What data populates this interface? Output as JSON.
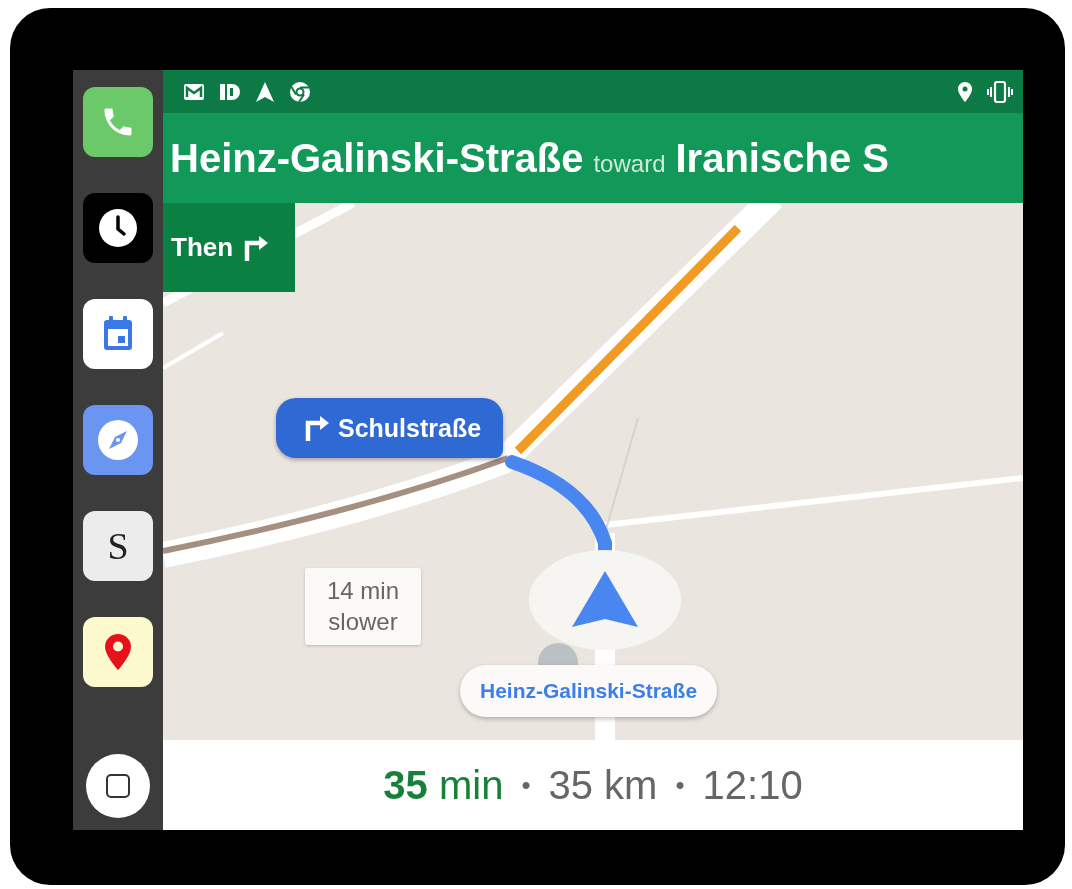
{
  "sidebar": {
    "apps": [
      {
        "kind": "phone",
        "color": "#6cc96a"
      },
      {
        "kind": "clock",
        "color": "#000000"
      },
      {
        "kind": "calendar",
        "color": "#ffffff"
      },
      {
        "kind": "compass",
        "color": "#6a95f0"
      },
      {
        "kind": "letter",
        "label": "S",
        "color": "#ececec"
      },
      {
        "kind": "maps",
        "color": "#fcf9cf"
      }
    ]
  },
  "navigation": {
    "street": "Heinz-Galinski-Straße",
    "connector": "toward",
    "destination": "Iranische S"
  },
  "next_step": {
    "label": "Then"
  },
  "turn_callout": {
    "street": "Schulstraße"
  },
  "traffic_note": {
    "text": "14 min slower"
  },
  "current_road": {
    "label": "Heinz-Galinski-Straße"
  },
  "trip": {
    "duration_value": "35",
    "duration_unit": "min",
    "separator_1": "•",
    "distance": "35 km",
    "separator_2": "•",
    "arrival": "12:10"
  }
}
